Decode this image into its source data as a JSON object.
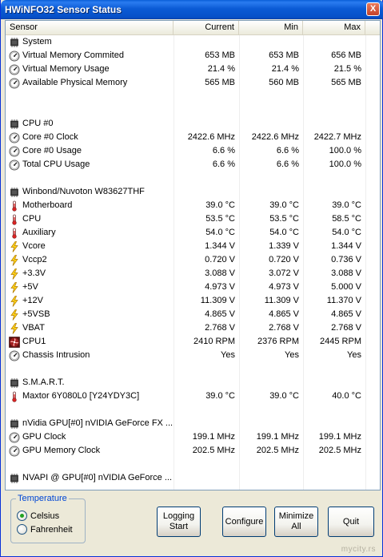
{
  "window": {
    "title": "HWiNFO32 Sensor Status",
    "close_label": "X"
  },
  "columns": [
    "Sensor",
    "Current",
    "Min",
    "Max"
  ],
  "rows": [
    {
      "type": "group",
      "name": "System"
    },
    {
      "type": "sensor",
      "icon": "gauge-icon",
      "name": "Virtual Memory Commited",
      "current": "653 MB",
      "min": "653 MB",
      "max": "656 MB"
    },
    {
      "type": "sensor",
      "icon": "gauge-icon",
      "name": "Virtual Memory Usage",
      "current": "21.4 %",
      "min": "21.4 %",
      "max": "21.5 %"
    },
    {
      "type": "sensor",
      "icon": "gauge-icon",
      "name": "Available Physical Memory",
      "current": "565 MB",
      "min": "560 MB",
      "max": "565 MB"
    },
    {
      "type": "blank"
    },
    {
      "type": "blank"
    },
    {
      "type": "group",
      "name": "CPU #0"
    },
    {
      "type": "sensor",
      "icon": "gauge-icon",
      "name": "Core #0 Clock",
      "current": "2422.6 MHz",
      "min": "2422.6 MHz",
      "max": "2422.7 MHz"
    },
    {
      "type": "sensor",
      "icon": "gauge-icon",
      "name": "Core #0 Usage",
      "current": "6.6 %",
      "min": "6.6 %",
      "max": "100.0 %"
    },
    {
      "type": "sensor",
      "icon": "gauge-icon",
      "name": "Total CPU Usage",
      "current": "6.6 %",
      "min": "6.6 %",
      "max": "100.0 %"
    },
    {
      "type": "blank"
    },
    {
      "type": "group",
      "name": "Winbond/Nuvoton W83627THF"
    },
    {
      "type": "sensor",
      "icon": "thermometer-icon",
      "name": "Motherboard",
      "current": "39.0 °C",
      "min": "39.0 °C",
      "max": "39.0 °C"
    },
    {
      "type": "sensor",
      "icon": "thermometer-icon",
      "name": "CPU",
      "current": "53.5 °C",
      "min": "53.5 °C",
      "max": "58.5 °C"
    },
    {
      "type": "sensor",
      "icon": "thermometer-icon",
      "name": "Auxiliary",
      "current": "54.0 °C",
      "min": "54.0 °C",
      "max": "54.0 °C"
    },
    {
      "type": "sensor",
      "icon": "lightning-icon",
      "name": "Vcore",
      "current": "1.344 V",
      "min": "1.339 V",
      "max": "1.344 V"
    },
    {
      "type": "sensor",
      "icon": "lightning-icon",
      "name": "Vccp2",
      "current": "0.720 V",
      "min": "0.720 V",
      "max": "0.736 V"
    },
    {
      "type": "sensor",
      "icon": "lightning-icon",
      "name": "+3.3V",
      "current": "3.088 V",
      "min": "3.072 V",
      "max": "3.088 V"
    },
    {
      "type": "sensor",
      "icon": "lightning-icon",
      "name": "+5V",
      "current": "4.973 V",
      "min": "4.973 V",
      "max": "5.000 V"
    },
    {
      "type": "sensor",
      "icon": "lightning-icon",
      "name": "+12V",
      "current": "11.309 V",
      "min": "11.309 V",
      "max": "11.370 V"
    },
    {
      "type": "sensor",
      "icon": "lightning-icon",
      "name": "+5VSB",
      "current": "4.865 V",
      "min": "4.865 V",
      "max": "4.865 V"
    },
    {
      "type": "sensor",
      "icon": "lightning-icon",
      "name": "VBAT",
      "current": "2.768 V",
      "min": "2.768 V",
      "max": "2.768 V"
    },
    {
      "type": "sensor",
      "icon": "fan-icon",
      "name": "CPU1",
      "current": "2410 RPM",
      "min": "2376 RPM",
      "max": "2445 RPM"
    },
    {
      "type": "sensor",
      "icon": "gauge-icon",
      "name": "Chassis Intrusion",
      "current": "Yes",
      "min": "Yes",
      "max": "Yes"
    },
    {
      "type": "blank"
    },
    {
      "type": "group",
      "name": "S.M.A.R.T."
    },
    {
      "type": "sensor",
      "icon": "thermometer-icon",
      "name": "Maxtor 6Y080L0 [Y24YDY3C]",
      "current": "39.0 °C",
      "min": "39.0 °C",
      "max": "40.0 °C"
    },
    {
      "type": "blank"
    },
    {
      "type": "group",
      "name": "nVidia GPU[#0] nVIDIA GeForce FX ..."
    },
    {
      "type": "sensor",
      "icon": "gauge-icon",
      "name": "GPU Clock",
      "current": "199.1 MHz",
      "min": "199.1 MHz",
      "max": "199.1 MHz"
    },
    {
      "type": "sensor",
      "icon": "gauge-icon",
      "name": "GPU Memory Clock",
      "current": "202.5 MHz",
      "min": "202.5 MHz",
      "max": "202.5 MHz"
    },
    {
      "type": "blank"
    },
    {
      "type": "group",
      "name": "NVAPI @ GPU[#0] nVIDIA GeForce ..."
    },
    {
      "type": "blank"
    }
  ],
  "temperature": {
    "legend": "Temperature",
    "options": [
      "Celsius",
      "Fahrenheit"
    ],
    "selected": "Celsius"
  },
  "buttons": {
    "logging": "Logging\nStart",
    "configure": "Configure",
    "minimize": "Minimize\nAll",
    "quit": "Quit"
  },
  "watermark": "mycity.rs",
  "colors": {
    "title_bar": "#0b5bd5",
    "window_bg": "#ece9d8",
    "grid_bg": "#ffffff",
    "accent": "#0046d5"
  }
}
